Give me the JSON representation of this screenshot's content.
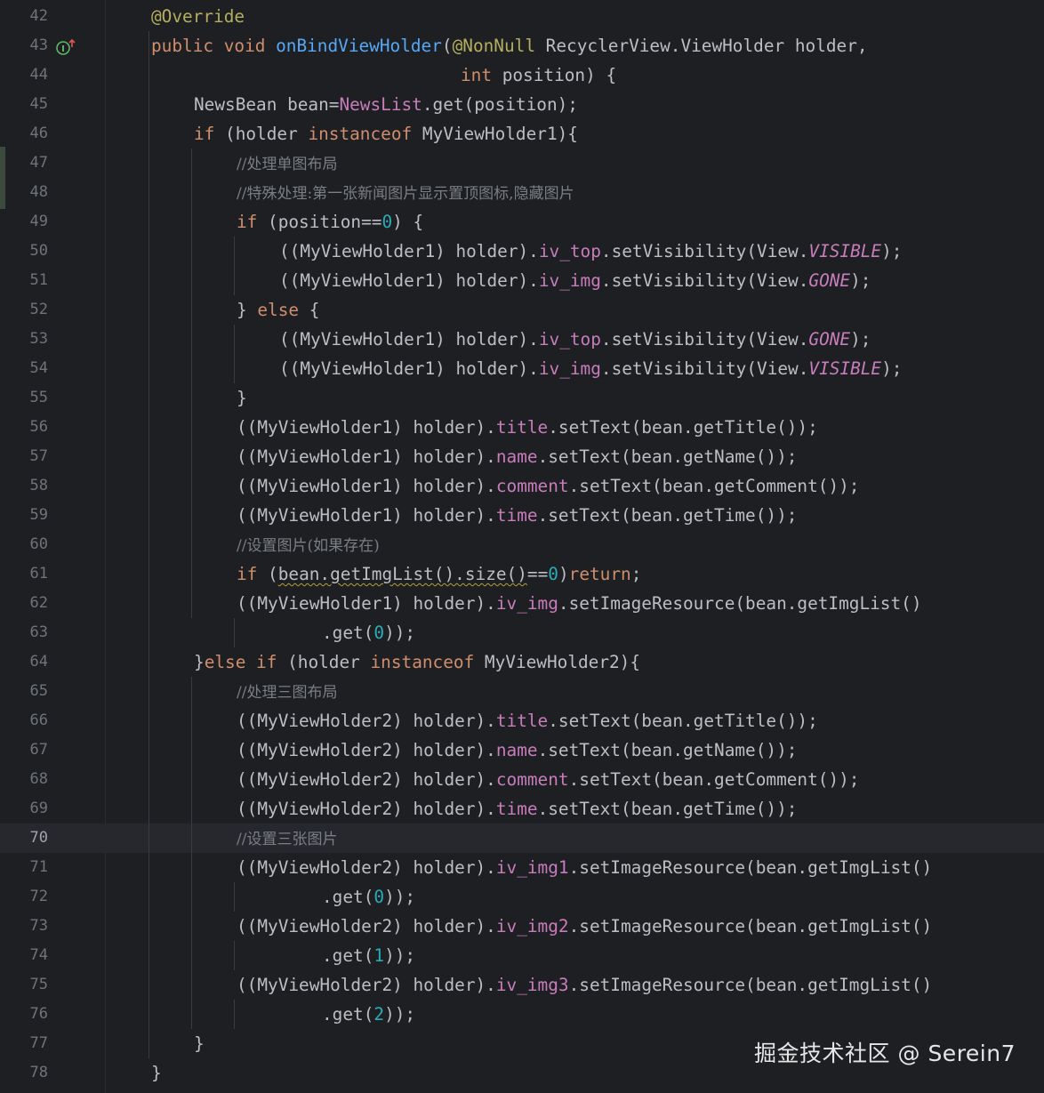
{
  "editor": {
    "current_line": "70",
    "colors": {
      "background": "#1e1f22",
      "keyword": "#cf8e6d",
      "annotation": "#b3ae60",
      "method_decl": "#56a8f5",
      "field": "#c77dbb",
      "number": "#2aacb8",
      "comment": "#7a7e85",
      "text": "#bcbec4"
    },
    "gutter_icons": [
      {
        "line": "43",
        "icon": "implementing-method-icon"
      }
    ]
  },
  "lines": [
    {
      "n": "42",
      "indent": 0,
      "tokens": [
        [
          "@Override",
          "ann"
        ]
      ]
    },
    {
      "n": "43",
      "indent": 0,
      "tokens": [
        [
          "public ",
          "kw"
        ],
        [
          "void ",
          "kw"
        ],
        [
          "onBindViewHolder",
          "fn"
        ],
        [
          "(",
          ""
        ],
        [
          "@NonNull",
          "ann"
        ],
        [
          " RecyclerView.ViewHolder holder,",
          ""
        ]
      ]
    },
    {
      "n": "44",
      "indent": 7.25,
      "tokens": [
        [
          "int ",
          "kw"
        ],
        [
          "position) {",
          ""
        ]
      ]
    },
    {
      "n": "45",
      "indent": 1,
      "tokens": [
        [
          "NewsBean bean=",
          ""
        ],
        [
          "NewsList",
          "field"
        ],
        [
          ".get(position);",
          ""
        ]
      ]
    },
    {
      "n": "46",
      "indent": 1,
      "tokens": [
        [
          "if ",
          "kw"
        ],
        [
          "(holder ",
          ""
        ],
        [
          "instanceof ",
          "kw"
        ],
        [
          "MyViewHolder1){",
          ""
        ]
      ]
    },
    {
      "n": "47",
      "indent": 2,
      "tokens": [
        [
          "//处理单图布局",
          "cmt"
        ]
      ]
    },
    {
      "n": "48",
      "indent": 2,
      "tokens": [
        [
          "//特殊处理:第一张新闻图片显示置顶图标,隐藏图片",
          "cmt"
        ]
      ]
    },
    {
      "n": "49",
      "indent": 2,
      "tokens": [
        [
          "if ",
          "kw"
        ],
        [
          "(position==",
          ""
        ],
        [
          "0",
          "num"
        ],
        [
          ") {",
          ""
        ]
      ]
    },
    {
      "n": "50",
      "indent": 3,
      "tokens": [
        [
          "((MyViewHolder1) holder).",
          ""
        ],
        [
          "iv_top",
          "field"
        ],
        [
          ".setVisibility(View.",
          ""
        ],
        [
          "VISIBLE",
          "const"
        ],
        [
          ");",
          ""
        ]
      ]
    },
    {
      "n": "51",
      "indent": 3,
      "tokens": [
        [
          "((MyViewHolder1) holder).",
          ""
        ],
        [
          "iv_img",
          "field"
        ],
        [
          ".setVisibility(View.",
          ""
        ],
        [
          "GONE",
          "const"
        ],
        [
          ");",
          ""
        ]
      ]
    },
    {
      "n": "52",
      "indent": 2,
      "tokens": [
        [
          "} ",
          ""
        ],
        [
          "else ",
          "kw"
        ],
        [
          "{",
          ""
        ]
      ]
    },
    {
      "n": "53",
      "indent": 3,
      "tokens": [
        [
          "((MyViewHolder1) holder).",
          ""
        ],
        [
          "iv_top",
          "field"
        ],
        [
          ".setVisibility(View.",
          ""
        ],
        [
          "GONE",
          "const"
        ],
        [
          ");",
          ""
        ]
      ]
    },
    {
      "n": "54",
      "indent": 3,
      "tokens": [
        [
          "((MyViewHolder1) holder).",
          ""
        ],
        [
          "iv_img",
          "field"
        ],
        [
          ".setVisibility(View.",
          ""
        ],
        [
          "VISIBLE",
          "const"
        ],
        [
          ");",
          ""
        ]
      ]
    },
    {
      "n": "55",
      "indent": 2,
      "tokens": [
        [
          "}",
          ""
        ]
      ]
    },
    {
      "n": "56",
      "indent": 2,
      "tokens": [
        [
          "((MyViewHolder1) holder).",
          ""
        ],
        [
          "title",
          "field"
        ],
        [
          ".setText(bean.getTitle());",
          ""
        ]
      ]
    },
    {
      "n": "57",
      "indent": 2,
      "tokens": [
        [
          "((MyViewHolder1) holder).",
          ""
        ],
        [
          "name",
          "field"
        ],
        [
          ".setText(bean.getName());",
          ""
        ]
      ]
    },
    {
      "n": "58",
      "indent": 2,
      "tokens": [
        [
          "((MyViewHolder1) holder).",
          ""
        ],
        [
          "comment",
          "field"
        ],
        [
          ".setText(bean.getComment());",
          ""
        ]
      ]
    },
    {
      "n": "59",
      "indent": 2,
      "tokens": [
        [
          "((MyViewHolder1) holder).",
          ""
        ],
        [
          "time",
          "field"
        ],
        [
          ".setText(bean.getTime());",
          ""
        ]
      ]
    },
    {
      "n": "60",
      "indent": 2,
      "tokens": [
        [
          "//设置图片(如果存在)",
          "cmt"
        ]
      ]
    },
    {
      "n": "61",
      "indent": 2,
      "tokens": [
        [
          "if ",
          "kw"
        ],
        [
          "(",
          ""
        ],
        [
          "bean.getImgList().size()",
          "warn"
        ],
        [
          "==",
          ""
        ],
        [
          "0",
          "num"
        ],
        [
          ")",
          ""
        ],
        [
          "return",
          "kw"
        ],
        [
          ";",
          ""
        ]
      ]
    },
    {
      "n": "62",
      "indent": 2,
      "tokens": [
        [
          "((MyViewHolder1) holder).",
          ""
        ],
        [
          "iv_img",
          "field"
        ],
        [
          ".setImageResource(bean.getImgList()",
          ""
        ]
      ]
    },
    {
      "n": "63",
      "indent": 4,
      "tokens": [
        [
          ".get(",
          ""
        ],
        [
          "0",
          "num"
        ],
        [
          "));",
          ""
        ]
      ]
    },
    {
      "n": "64",
      "indent": 1,
      "tokens": [
        [
          "}",
          ""
        ],
        [
          "else if ",
          "kw"
        ],
        [
          "(holder ",
          ""
        ],
        [
          "instanceof ",
          "kw"
        ],
        [
          "MyViewHolder2){",
          ""
        ]
      ]
    },
    {
      "n": "65",
      "indent": 2,
      "tokens": [
        [
          "//处理三图布局",
          "cmt"
        ]
      ]
    },
    {
      "n": "66",
      "indent": 2,
      "tokens": [
        [
          "((MyViewHolder2) holder).",
          ""
        ],
        [
          "title",
          "field"
        ],
        [
          ".setText(bean.getTitle());",
          ""
        ]
      ]
    },
    {
      "n": "67",
      "indent": 2,
      "tokens": [
        [
          "((MyViewHolder2) holder).",
          ""
        ],
        [
          "name",
          "field"
        ],
        [
          ".setText(bean.getName());",
          ""
        ]
      ]
    },
    {
      "n": "68",
      "indent": 2,
      "tokens": [
        [
          "((MyViewHolder2) holder).",
          ""
        ],
        [
          "comment",
          "field"
        ],
        [
          ".setText(bean.getComment());",
          ""
        ]
      ]
    },
    {
      "n": "69",
      "indent": 2,
      "tokens": [
        [
          "((MyViewHolder2) holder).",
          ""
        ],
        [
          "time",
          "field"
        ],
        [
          ".setText(bean.getTime());",
          ""
        ]
      ]
    },
    {
      "n": "70",
      "indent": 2,
      "tokens": [
        [
          "//设置三张图片",
          "cmt"
        ]
      ]
    },
    {
      "n": "71",
      "indent": 2,
      "tokens": [
        [
          "((MyViewHolder2) holder).",
          ""
        ],
        [
          "iv_img1",
          "field"
        ],
        [
          ".setImageResource(bean.getImgList()",
          ""
        ]
      ]
    },
    {
      "n": "72",
      "indent": 4,
      "tokens": [
        [
          ".get(",
          ""
        ],
        [
          "0",
          "num"
        ],
        [
          "));",
          ""
        ]
      ]
    },
    {
      "n": "73",
      "indent": 2,
      "tokens": [
        [
          "((MyViewHolder2) holder).",
          ""
        ],
        [
          "iv_img2",
          "field"
        ],
        [
          ".setImageResource(bean.getImgList()",
          ""
        ]
      ]
    },
    {
      "n": "74",
      "indent": 4,
      "tokens": [
        [
          ".get(",
          ""
        ],
        [
          "1",
          "num"
        ],
        [
          "));",
          ""
        ]
      ]
    },
    {
      "n": "75",
      "indent": 2,
      "tokens": [
        [
          "((MyViewHolder2) holder).",
          ""
        ],
        [
          "iv_img3",
          "field"
        ],
        [
          ".setImageResource(bean.getImgList()",
          ""
        ]
      ]
    },
    {
      "n": "76",
      "indent": 4,
      "tokens": [
        [
          ".get(",
          ""
        ],
        [
          "2",
          "num"
        ],
        [
          "));",
          ""
        ]
      ]
    },
    {
      "n": "77",
      "indent": 1,
      "tokens": [
        [
          "}",
          ""
        ]
      ]
    },
    {
      "n": "78",
      "indent": 0,
      "tokens": [
        [
          "}",
          ""
        ]
      ]
    }
  ],
  "watermark": "掘金技术社区 @ Serein7"
}
